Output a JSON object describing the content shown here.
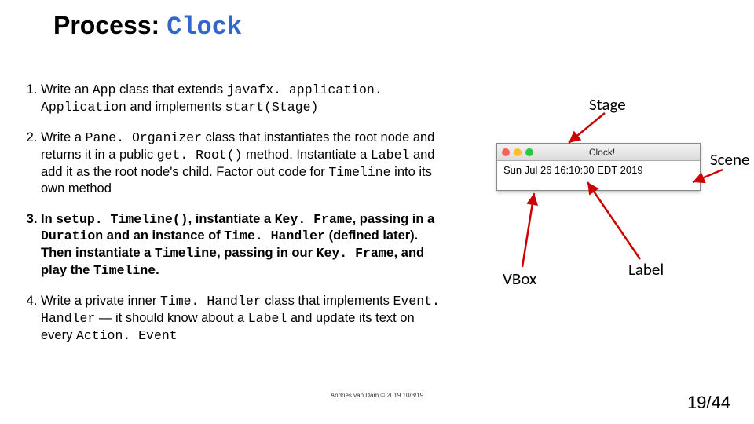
{
  "title": {
    "prefix": "Process: ",
    "code": "Clock"
  },
  "steps": {
    "s1a": "Write an ",
    "s1b": "App",
    "s1c": " class that extends ",
    "s1d": "javafx. application. Application",
    "s1e": " and implements ",
    "s1f": "start(Stage)",
    "s2a": "Write a ",
    "s2b": "Pane. Organizer",
    "s2c": " class that instantiates the root node and returns it in a public ",
    "s2d": "get. Root()",
    "s2e": " method. Instantiate a ",
    "s2f": "Label",
    "s2g": " and add it as the root node's child. Factor out code for ",
    "s2h": "Timeline",
    "s2i": " into its own method",
    "s3a": "In ",
    "s3b": "setup. Timeline()",
    "s3c": ",  instantiate a ",
    "s3d": "Key. Frame",
    "s3e": ", passing in a ",
    "s3f": "Duration",
    "s3g": " and an instance of ",
    "s3h": "Time. Handler",
    "s3i": " (defined later). Then instantiate a ",
    "s3j": "Timeline",
    "s3k": ", passing in our ",
    "s3l": "Key. Frame",
    "s3m": ", and play the ",
    "s3n": "Timeline",
    "s3o": ".",
    "s4a": "Write a private inner ",
    "s4b": "Time. Handler",
    "s4c": " class that implements ",
    "s4d": "Event. Handler",
    "s4e": " — it should know about a ",
    "s4f": "Label",
    "s4g": " and update its text on every ",
    "s4h": "Action. Event"
  },
  "window": {
    "title": "Clock!",
    "label_text": "Sun Jul 26 16:10:30 EDT 2019"
  },
  "callouts": {
    "stage": "Stage",
    "scene": "Scene",
    "vbox": "VBox",
    "label": "Label"
  },
  "footer": "Andries van Dam © 2019 10/3/19",
  "page": "19/44"
}
